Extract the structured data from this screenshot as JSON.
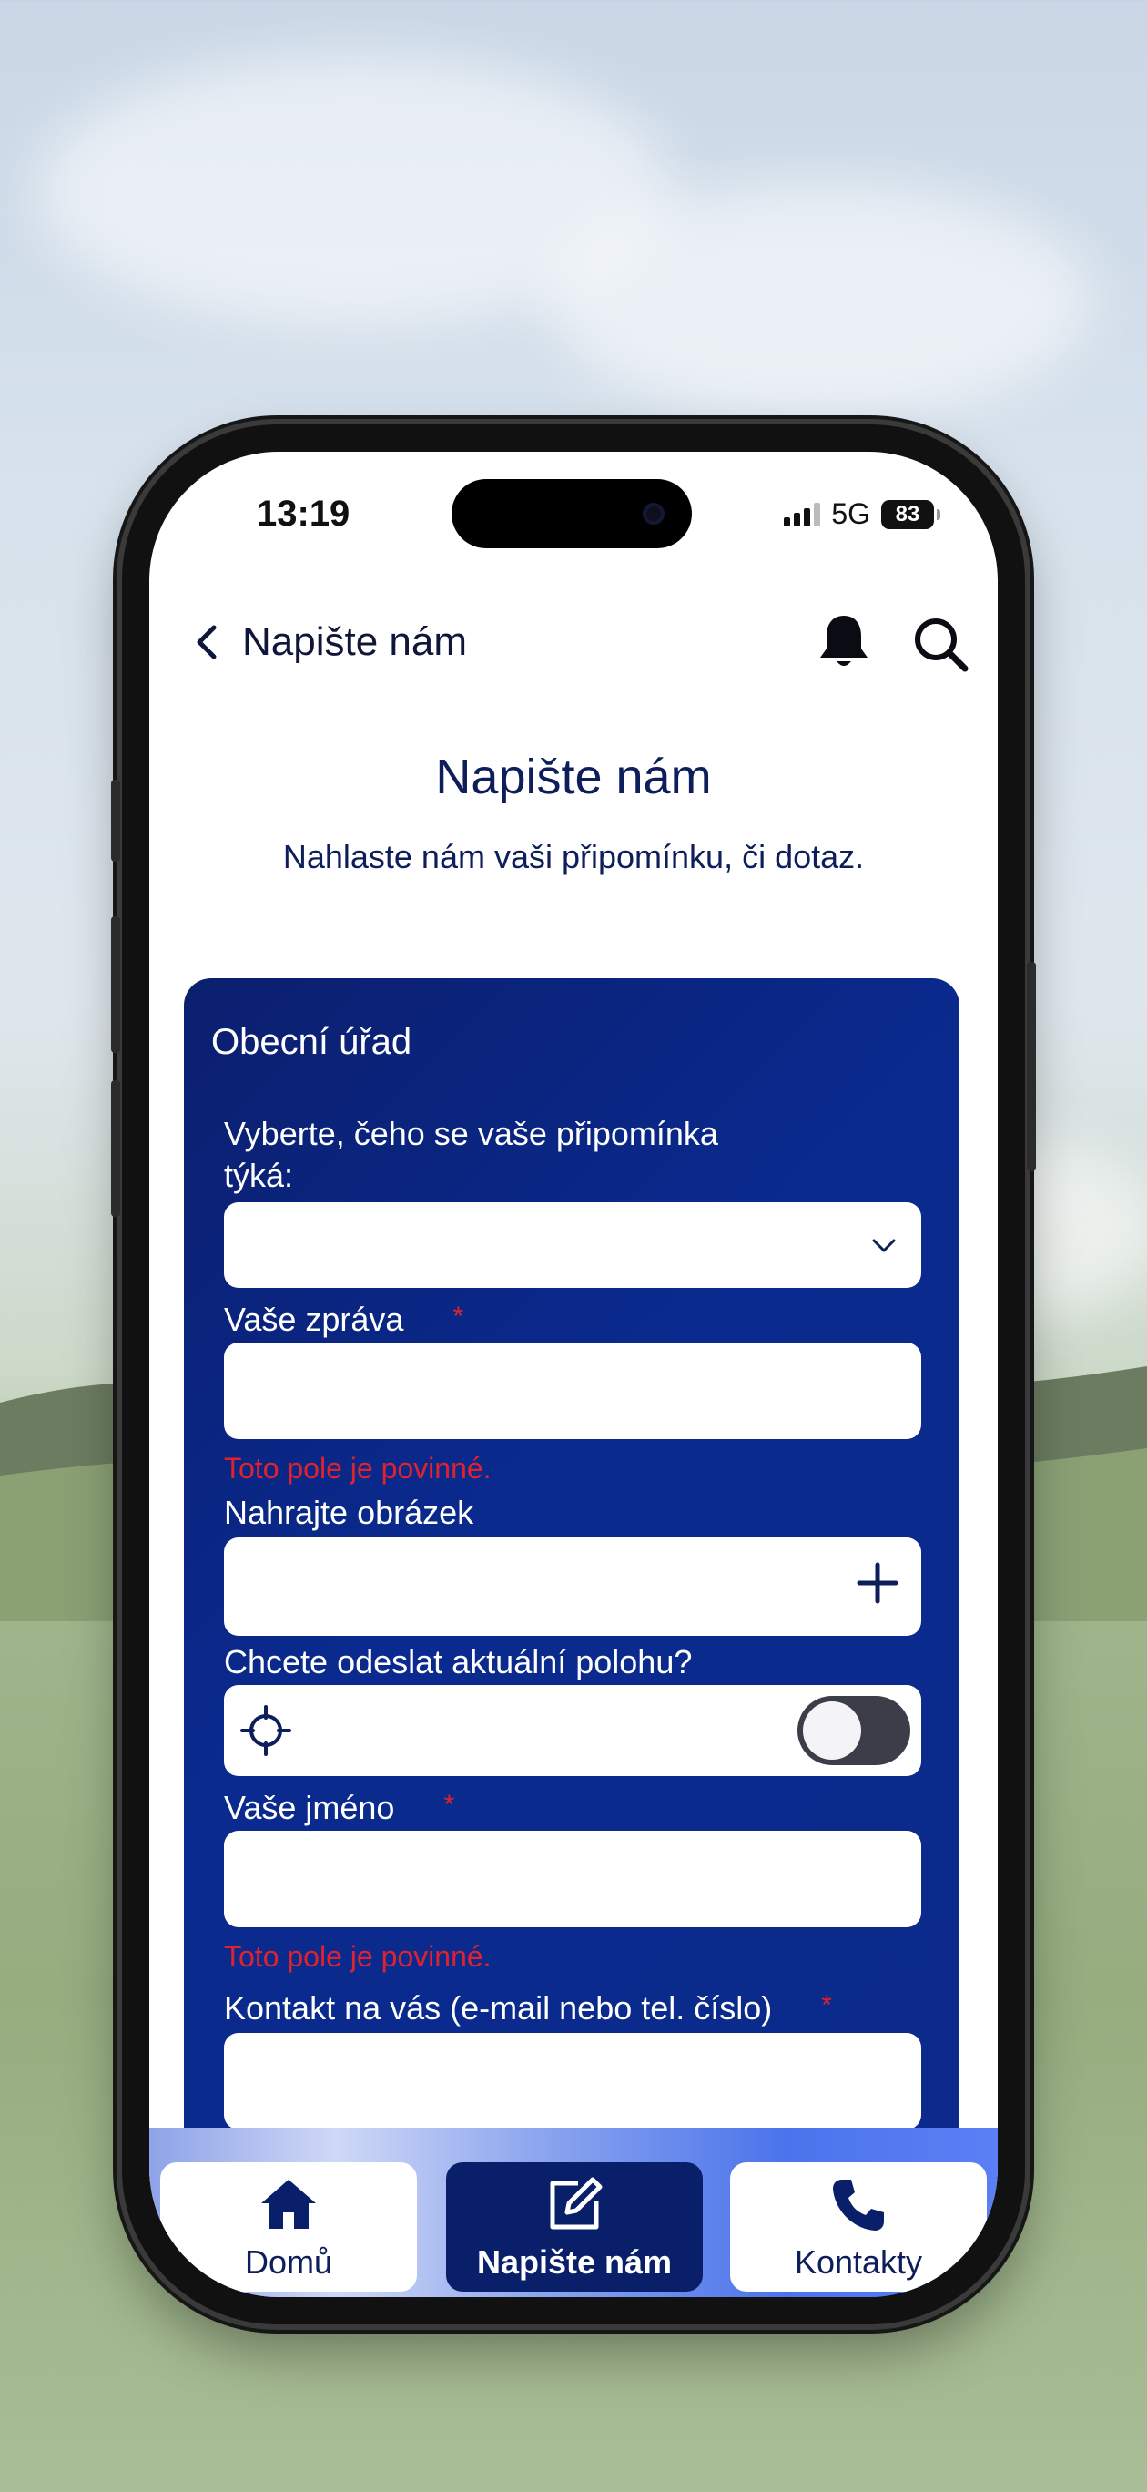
{
  "status_bar": {
    "time": "13:19",
    "network": "5G",
    "battery": "83"
  },
  "header": {
    "title": "Napište nám"
  },
  "page": {
    "title": "Napište nám",
    "subtitle": "Nahlaste nám vaši připomínku, či dotaz."
  },
  "form": {
    "section_title": "Obecní úřad",
    "topic_label_line1": "Vyberte, čeho se vaše připomínka",
    "topic_label_line2": "týká:",
    "topic_value": "",
    "message_label": "Vaše zpráva",
    "message_value": "",
    "message_error": "Toto pole je povinné.",
    "image_label": "Nahrajte obrázek",
    "location_label": "Chcete odeslat aktuální polohu?",
    "location_enabled": false,
    "name_label": "Vaše jméno",
    "name_value": "",
    "name_error": "Toto pole je povinné.",
    "contact_label": "Kontakt na vás (e-mail nebo tel. číslo)",
    "contact_value": "",
    "required_mark": "*"
  },
  "tabbar": {
    "items": [
      {
        "label": "Domů",
        "icon": "home-icon",
        "active": false
      },
      {
        "label": "Napište nám",
        "icon": "edit-icon",
        "active": true
      },
      {
        "label": "Kontakty",
        "icon": "phone-icon",
        "active": false
      }
    ]
  },
  "colors": {
    "primary": "#0a1f6a",
    "card": "#0a2a8f",
    "error": "#e0222f",
    "title_text": "#0e1e5b"
  }
}
